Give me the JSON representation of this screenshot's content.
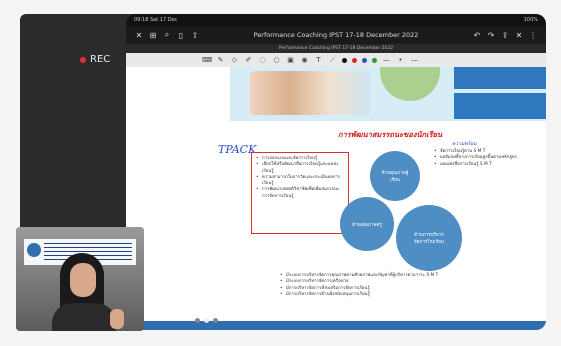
{
  "meeting": {
    "rec_label": "REC"
  },
  "tablet": {
    "status_left": "09:18  Sat 17 Dec",
    "status_right": "100%",
    "app_title": "Performance Coaching IPST 17-18 December 2022",
    "tab_title": "Performance Coaching IPST 17-18 December 2022",
    "pen_colors": [
      "#111111",
      "#d62828",
      "#2d4fd8",
      "#2c9a3a"
    ]
  },
  "slide": {
    "handwritten_tpack": "TPACK",
    "handwritten_title": "การพัฒนาสมรรถนะของนักเรียน",
    "handwritten_note": "ความพร้อม",
    "banner_box1": "",
    "banner_box2": "",
    "redbox_items": [
      "การออกแบบและจัดการเรียนรู้",
      "เลือกใช้หรือพัฒนาสื่อการเรียนรู้และแหล่งเรียนรู้",
      "ความสามารถในการวัดและประเมินผลการเรียนรู้",
      "การพัฒนาเจตคติวิชาชีพเพื่อเพิ่มสมรรถนะการจัดการเรียนรู้"
    ],
    "gear_top": "ด้านคุณภาพผู้เรียน",
    "gear_mid": "ด้านคุณภาพครู",
    "gear_big": "ด้านการบริหารจัดการโรงเรียน",
    "right_items": [
      "จัดการเรียนรู้ตาม S M T",
      "ผลสัมฤทธิ์ทางการเรียนสูงขึ้นตามหลักสูตร",
      "เผยแพร่สื่อการเรียนรู้ S M T"
    ],
    "bottom_items": [
      "มีระบบการบริหารจัดการคุณภาพตามศักยภาพและปัญหาที่ผู้บริหารตามวาระ S M T",
      "มีระบบการบริหารจัดการเครือข่าย",
      "มีการบริหารจัดการที่ส่งเสริมการจัดการเรียนรู้",
      "มีการบริหารจัดการด้านสิ่งสนับสนุนการเรียนรู้"
    ]
  }
}
